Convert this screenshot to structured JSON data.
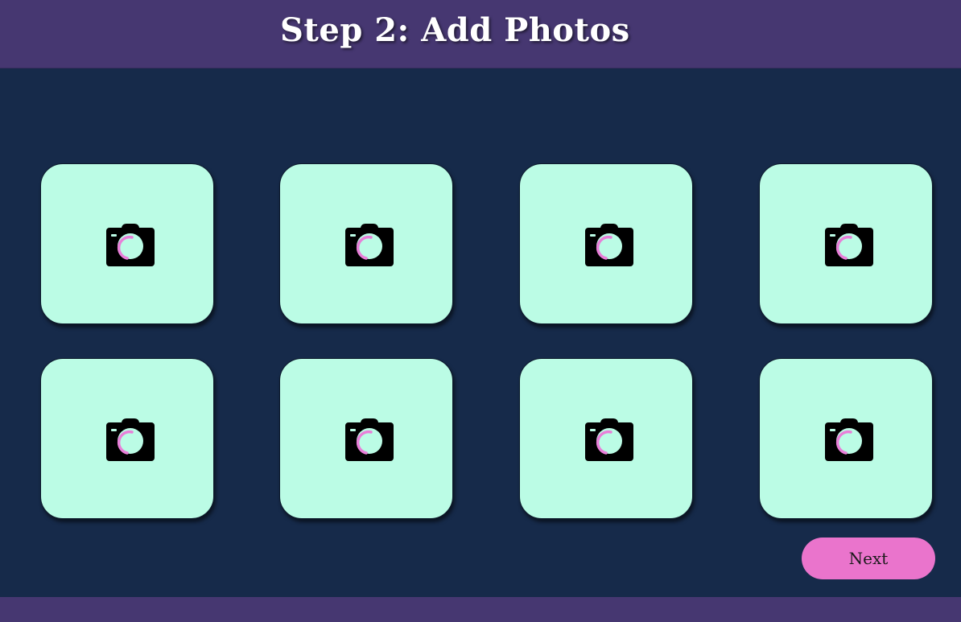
{
  "header": {
    "title": "Step 2: Add Photos"
  },
  "slots": [
    {
      "icon": "camera-icon"
    },
    {
      "icon": "camera-icon"
    },
    {
      "icon": "camera-icon"
    },
    {
      "icon": "camera-icon"
    },
    {
      "icon": "camera-icon"
    },
    {
      "icon": "camera-icon"
    },
    {
      "icon": "camera-icon"
    },
    {
      "icon": "camera-icon"
    }
  ],
  "actions": {
    "next_label": "Next"
  },
  "colors": {
    "background": "#162a4a",
    "header": "#463771",
    "slot": "#bbfce5",
    "accent": "#ea74cc",
    "title": "#ffffff"
  }
}
